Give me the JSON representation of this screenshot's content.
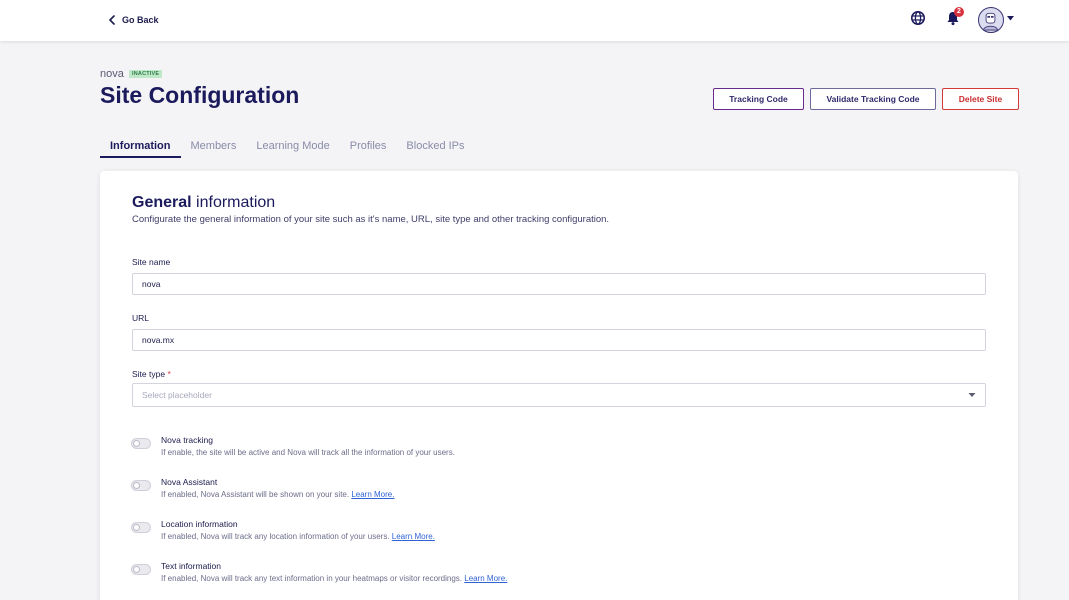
{
  "topbar": {
    "go_back_label": "Go Back",
    "notification_count": "2",
    "icons": [
      "chevron-left-icon",
      "globe-icon",
      "bell-icon",
      "avatar-icon",
      "caret-down-icon"
    ]
  },
  "header": {
    "site_name": "nova",
    "status": "INACTIVE",
    "title": "Site Configuration",
    "buttons": {
      "tracking_code": "Tracking Code",
      "validate_tracking_code": "Validate Tracking Code",
      "delete_site": "Delete Site"
    }
  },
  "tabs": [
    {
      "label": "Information",
      "active": true
    },
    {
      "label": "Members",
      "active": false
    },
    {
      "label": "Learning Mode",
      "active": false
    },
    {
      "label": "Profiles",
      "active": false
    },
    {
      "label": "Blocked IPs",
      "active": false
    }
  ],
  "general": {
    "title_bold": "General",
    "title_rest": " information",
    "description": "Configurate the general information of your site such as it's name, URL, site type and other tracking configuration.",
    "site_name_label": "Site name",
    "site_name_value": "nova",
    "url_label": "URL",
    "url_value": "nova.mx",
    "site_type_label": "Site type",
    "site_type_required": "*",
    "site_type_placeholder": "Select placeholder"
  },
  "toggles": [
    {
      "title": "Nova tracking",
      "desc": "If enable, the site will be active and Nova will track all the information of your users.",
      "link": "",
      "enabled": false
    },
    {
      "title": "Nova Assistant",
      "desc": "If enabled, Nova Assistant will be shown on your site. ",
      "link": "Learn More.",
      "enabled": false
    },
    {
      "title": "Location information",
      "desc": "If enabled, Nova will track any location information of your users. ",
      "link": "Learn More.",
      "enabled": false
    },
    {
      "title": "Text information",
      "desc": "If enabled, Nova will track any text information in your heatmaps or visitor recordings. ",
      "link": "Learn More.",
      "enabled": false
    }
  ],
  "colors": {
    "primary": "#1b1a5c",
    "danger": "#d33a3a",
    "link": "#2f63d6",
    "badge_bg": "#bfe8c9"
  }
}
